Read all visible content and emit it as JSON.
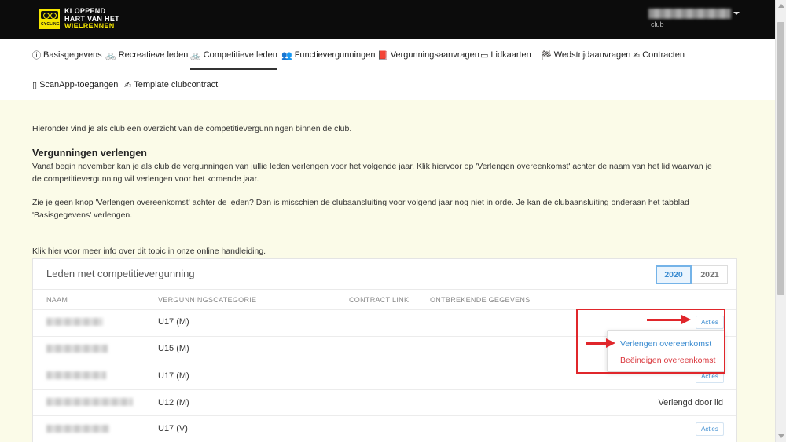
{
  "header": {
    "logo_lines": [
      "KLOPPEND",
      "HART VAN HET",
      "WIELRENNEN"
    ],
    "logo_mark_text": "CYCLING",
    "user_role": "club"
  },
  "nav": {
    "tabs": [
      {
        "label": "Basisgegevens",
        "icon": "ⓘ",
        "icon_name": "info-icon"
      },
      {
        "label": "Recreatieve leden",
        "icon": "🚲",
        "icon_name": "bicycle-icon"
      },
      {
        "label": "Competitieve leden",
        "icon": "🚲",
        "icon_name": "bicycle-icon"
      },
      {
        "label": "Functievergunningen",
        "icon": "👥",
        "icon_name": "users-icon"
      },
      {
        "label": "Vergunningsaanvragen",
        "icon": "📕",
        "icon_name": "book-icon"
      },
      {
        "label": "Lidkaarten",
        "icon": "▭",
        "icon_name": "card-icon"
      },
      {
        "label": "Wedstrijdaanvragen",
        "icon": "🏁",
        "icon_name": "flag-icon"
      },
      {
        "label": "Contracten",
        "icon": "✍",
        "icon_name": "signature-icon"
      },
      {
        "label": "ScanApp-toegangen",
        "icon": "▯",
        "icon_name": "mobile-icon"
      },
      {
        "label": "Template clubcontract",
        "icon": "✍",
        "icon_name": "signature-icon"
      }
    ],
    "active_index": 2
  },
  "content": {
    "intro": "Hieronder vind je als club een overzicht van de competitievergunningen binnen de club.",
    "renew_heading": "Vergunningen verlengen",
    "renew_text": "Vanaf begin november kan je als club de vergunningen van jullie leden verlengen voor het volgende jaar. Klik hiervoor op 'Verlengen overeenkomst' achter de naam van het lid waarvan je de competitievergunning wil verlengen voor het komende jaar.",
    "no_button_text": "Zie je geen knop 'Verlengen overeenkomst' achter de leden? Dan is misschien de clubaansluiting voor volgend jaar nog niet in orde. Je kan de clubaansluiting onderaan het tabblad 'Basisgegevens' verlengen.",
    "info_link": "Klik hier voor meer info over dit topic in onze online handleiding."
  },
  "card": {
    "title": "Leden met competitievergunning",
    "years": [
      "2020",
      "2021"
    ],
    "selected_year": "2020",
    "columns": [
      "NAAM",
      "VERGUNNINGSCATEGORIE",
      "CONTRACT LINK",
      "ONTBREKENDE GEGEVENS"
    ],
    "rows": [
      {
        "category": "U17 (M)",
        "action": "Acties",
        "status": ""
      },
      {
        "category": "U15 (M)",
        "action": "",
        "status": ""
      },
      {
        "category": "U17 (M)",
        "action": "Acties",
        "status": ""
      },
      {
        "category": "U12 (M)",
        "action": "",
        "status": "Verlengd door lid"
      },
      {
        "category": "U17 (V)",
        "action": "Acties",
        "status": ""
      }
    ]
  },
  "dropdown": {
    "renew": "Verlengen overeenkomst",
    "end": "Beëindigen overeenkomst"
  },
  "colors": {
    "topbar": "#0c0c0c",
    "brand_yellow": "#f5e600",
    "page_bg": "#fbfbe8",
    "link_blue": "#3a8bd0",
    "danger_red": "#d9343a",
    "annotation_red": "#e0262b"
  }
}
